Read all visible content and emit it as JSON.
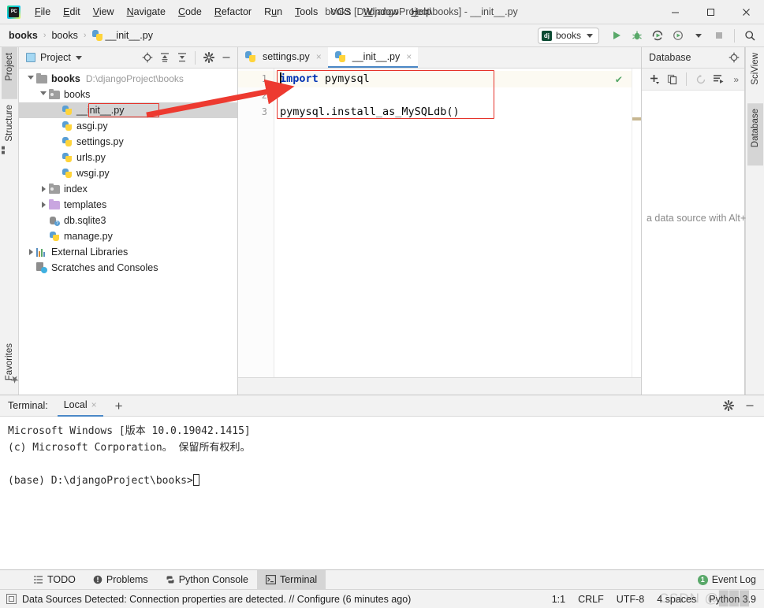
{
  "window": {
    "title": "books [D:\\djangoProject\\books] - __init__.py",
    "app_icon": "pycharm-logo-icon",
    "minimize": "—",
    "maximize": "☐",
    "close": "✕"
  },
  "menubar": {
    "items": [
      {
        "label": "File",
        "mnemonic": "F"
      },
      {
        "label": "Edit",
        "mnemonic": "E"
      },
      {
        "label": "View",
        "mnemonic": "V"
      },
      {
        "label": "Navigate",
        "mnemonic": "N"
      },
      {
        "label": "Code",
        "mnemonic": "C"
      },
      {
        "label": "Refactor",
        "mnemonic": "R"
      },
      {
        "label": "Run",
        "mnemonic": "u"
      },
      {
        "label": "Tools",
        "mnemonic": "T"
      },
      {
        "label": "VCS",
        "mnemonic": ""
      },
      {
        "label": "Window",
        "mnemonic": "W"
      },
      {
        "label": "Help",
        "mnemonic": "H"
      }
    ]
  },
  "breadcrumb": {
    "items": [
      "books",
      "books",
      "__init__.py"
    ],
    "separator": "›",
    "file_icon": "python-file-icon"
  },
  "run_toolbar": {
    "config_name": "books",
    "config_icon": "django-icon",
    "dropdown_icon": "chevron-down-icon",
    "buttons": [
      {
        "name": "run-button",
        "icon": "run-play-icon"
      },
      {
        "name": "debug-button",
        "icon": "debug-bug-icon"
      },
      {
        "name": "run-coverage-button",
        "icon": "run-coverage-icon"
      },
      {
        "name": "profile-button",
        "icon": "profile-clock-icon"
      },
      {
        "name": "profile-dropdown",
        "icon": "chevron-down-icon"
      },
      {
        "name": "stop-button",
        "icon": "stop-square-icon"
      },
      {
        "name": "search-everywhere-button",
        "icon": "search-icon"
      }
    ]
  },
  "left_strip": {
    "tabs": [
      {
        "label": "Project",
        "icon": "project-folder-icon",
        "active": true
      },
      {
        "label": "Structure",
        "icon": "structure-icon",
        "active": false
      }
    ],
    "bottom_tabs": [
      {
        "label": "Favorites",
        "icon": "star-icon",
        "active": false
      }
    ]
  },
  "right_strip": {
    "tabs": [
      {
        "label": "SciView",
        "icon": "grid-icon",
        "active": false
      },
      {
        "label": "Database",
        "icon": "database-cylinder-icon",
        "active": true
      }
    ]
  },
  "project_panel": {
    "title": "Project",
    "title_icon": "project-icon",
    "dropdown_icon": "chevron-down-icon",
    "tools": [
      {
        "name": "select-opened-file-button",
        "icon": "target-icon"
      },
      {
        "name": "expand-all-button",
        "icon": "expand-all-icon"
      },
      {
        "name": "collapse-all-button",
        "icon": "collapse-all-icon"
      },
      {
        "name": "settings-button",
        "icon": "gear-icon"
      },
      {
        "name": "hide-button",
        "icon": "minus-icon"
      }
    ],
    "tree": [
      {
        "label": "books",
        "path": "D:\\djangoProject\\books",
        "icon": "folder-icon",
        "indent": 0,
        "twisty": "open",
        "bold": true,
        "selected": false,
        "highlighted": false
      },
      {
        "label": "books",
        "path": "",
        "icon": "folder-source-icon",
        "indent": 1,
        "twisty": "open",
        "bold": false,
        "selected": false,
        "highlighted": false
      },
      {
        "label": "__init__.py",
        "path": "",
        "icon": "python-file-icon",
        "indent": 2,
        "twisty": "none",
        "bold": false,
        "selected": true,
        "highlighted": true
      },
      {
        "label": "asgi.py",
        "path": "",
        "icon": "python-file-icon",
        "indent": 2,
        "twisty": "none",
        "bold": false,
        "selected": false,
        "highlighted": false
      },
      {
        "label": "settings.py",
        "path": "",
        "icon": "python-file-icon",
        "indent": 2,
        "twisty": "none",
        "bold": false,
        "selected": false,
        "highlighted": false
      },
      {
        "label": "urls.py",
        "path": "",
        "icon": "python-file-icon",
        "indent": 2,
        "twisty": "none",
        "bold": false,
        "selected": false,
        "highlighted": false
      },
      {
        "label": "wsgi.py",
        "path": "",
        "icon": "python-file-icon",
        "indent": 2,
        "twisty": "none",
        "bold": false,
        "selected": false,
        "highlighted": false
      },
      {
        "label": "index",
        "path": "",
        "icon": "folder-source-icon",
        "indent": 1,
        "twisty": "closed",
        "bold": false,
        "selected": false,
        "highlighted": false
      },
      {
        "label": "templates",
        "path": "",
        "icon": "folder-template-icon",
        "indent": 1,
        "twisty": "closed",
        "bold": false,
        "selected": false,
        "highlighted": false
      },
      {
        "label": "db.sqlite3",
        "path": "",
        "icon": "sqlite-db-icon",
        "indent": 1,
        "twisty": "none",
        "bold": false,
        "selected": false,
        "highlighted": false
      },
      {
        "label": "manage.py",
        "path": "",
        "icon": "python-file-icon",
        "indent": 1,
        "twisty": "none",
        "bold": false,
        "selected": false,
        "highlighted": false
      },
      {
        "label": "External Libraries",
        "path": "",
        "icon": "libraries-icon",
        "indent": 0,
        "twisty": "closed",
        "bold": false,
        "selected": false,
        "highlighted": false
      },
      {
        "label": "Scratches and Consoles",
        "path": "",
        "icon": "scratches-icon",
        "indent": 0,
        "twisty": "none",
        "bold": false,
        "selected": false,
        "highlighted": false
      }
    ]
  },
  "editor": {
    "tabs": [
      {
        "label": "settings.py",
        "icon": "python-file-icon",
        "active": false,
        "close_icon": "×"
      },
      {
        "label": "__init__.py",
        "icon": "python-file-icon",
        "active": true,
        "close_icon": "×"
      }
    ],
    "line_numbers": [
      "1",
      "2",
      "3"
    ],
    "lines": [
      {
        "number": "1",
        "keyword": "import",
        "rest": " pymysql",
        "current": true
      },
      {
        "number": "2",
        "keyword": "",
        "rest": "",
        "current": false
      },
      {
        "number": "3",
        "keyword": "",
        "rest": "pymysql.install_as_MySQLdb()",
        "current": false
      }
    ],
    "inspection_status_icon": "checkmark-ok-icon",
    "annotation": {
      "type": "red-rectangle-highlight",
      "color": "#e5332a"
    }
  },
  "database_panel": {
    "title": "Database",
    "title_icon": "target-icon",
    "tools": [
      {
        "name": "add-data-source-button",
        "icon": "plus-icon"
      },
      {
        "name": "copy-button",
        "icon": "copy-icon"
      },
      {
        "name": "refresh-button",
        "icon": "refresh-icon"
      },
      {
        "name": "jump-to-query-console-button",
        "icon": "query-console-icon"
      },
      {
        "name": "more-button",
        "icon": "chevron-double-right-icon"
      }
    ],
    "empty_hint": "a data source with Alt+"
  },
  "terminal": {
    "label": "Terminal:",
    "tab": {
      "label": "Local",
      "close_icon": "×"
    },
    "add_icon": "plus-icon",
    "settings_icon": "gear-icon",
    "hide_icon": "minus-icon",
    "lines": [
      "Microsoft Windows [版本 10.0.19042.1415]",
      "(c) Microsoft Corporation。 保留所有权利。",
      "",
      "(base) D:\\djangoProject\\books>"
    ]
  },
  "bottom_tabs": {
    "items": [
      {
        "label": "TODO",
        "icon": "todo-list-icon",
        "active": false
      },
      {
        "label": "Problems",
        "icon": "problems-warning-icon",
        "active": false
      },
      {
        "label": "Python Console",
        "icon": "python-console-icon",
        "active": false
      },
      {
        "label": "Terminal",
        "icon": "terminal-icon",
        "active": true
      }
    ],
    "event_log": {
      "label": "Event Log",
      "badge": "1",
      "badge_color": "#59a869"
    }
  },
  "statusbar": {
    "icon": "detected-data-sources-icon",
    "message": "Data Sources Detected: Connection properties are detected. // Configure (6 minutes ago)",
    "right_items": [
      "1:1",
      "CRLF",
      "UTF-8",
      "4 spaces",
      "Python 3.9"
    ],
    "watermark": "CSDN @███"
  },
  "colors": {
    "accent_blue": "#4a88c7",
    "annotation_red": "#e5332a",
    "keyword_blue": "#0033b3",
    "success_green": "#59a869",
    "chrome_gray": "#f2f2f2"
  }
}
